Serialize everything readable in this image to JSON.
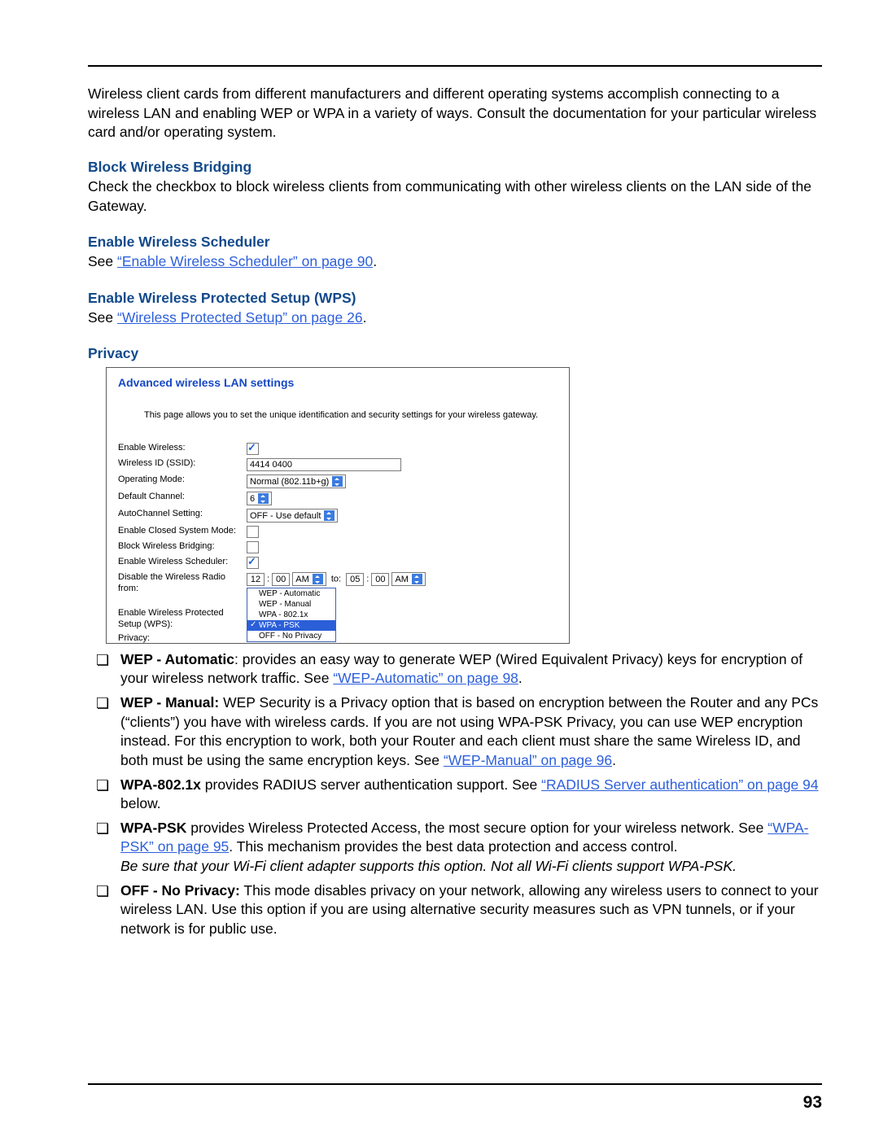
{
  "intro_text": "Wireless client cards from different manufacturers and different operating systems accomplish connecting to a wireless LAN and enabling WEP or WPA in a variety of ways. Consult the documentation for your particular wireless card and/or operating system.",
  "h1": {
    "title": "Block Wireless Bridging",
    "body": "Check the checkbox to block wireless clients from communicating with other wireless clients on the LAN side of the Gateway."
  },
  "h2": {
    "title": "Enable Wireless Scheduler",
    "see": "See ",
    "link": "“Enable Wireless Scheduler” on page 90",
    "after": "."
  },
  "h3": {
    "title": "Enable Wireless Protected Setup (WPS)",
    "see": "See ",
    "link": "“Wireless Protected Setup” on page 26",
    "after": "."
  },
  "h4": {
    "title": "Privacy"
  },
  "shot": {
    "title": "Advanced wireless LAN settings",
    "desc": "This page allows you to set the unique identification and security settings for your wireless gateway.",
    "rows": {
      "enable_wireless": "Enable Wireless:",
      "ssid_label": "Wireless ID (SSID):",
      "ssid_value": "4414 0400",
      "mode_label": "Operating Mode:",
      "mode_value": "Normal (802.11b+g)",
      "chan_label": "Default Channel:",
      "chan_value": "6",
      "auto_label": "AutoChannel Setting:",
      "auto_value": "OFF - Use default",
      "closed_label": "Enable Closed System Mode:",
      "block_label": "Block Wireless Bridging:",
      "sched_label": "Enable Wireless Scheduler:",
      "disable_label": "Disable the Wireless Radio from:",
      "disable_hh1": "12",
      "disable_mm1": "00",
      "disable_ap1": "AM",
      "to": "to:",
      "disable_hh2": "05",
      "disable_mm2": "00",
      "disable_ap2": "AM",
      "wps_label": "Enable Wireless Protected Setup (WPS):",
      "privacy_label": "Privacy:"
    },
    "privacy_opts": [
      "WEP - Automatic",
      "WEP - Manual",
      "WPA - 802.1x",
      "WPA - PSK",
      "OFF - No Privacy"
    ]
  },
  "list": {
    "wep_auto_b": "WEP - Automatic",
    "wep_auto_t1": ": provides an easy way to generate WEP (Wired Equivalent Privacy) keys for encryption of your wireless network traffic. See ",
    "wep_auto_link": "“WEP-Automatic” on page 98",
    "wep_auto_t2": ".",
    "wep_man_b": "WEP - Manual:",
    "wep_man_t1": " WEP Security is a Privacy option that is based on encryption between the Router and any PCs (“clients”) you have with wireless cards. If you are not using WPA-PSK Privacy, you can use WEP encryption instead. For this encryption to work, both your Router and each client must share the same Wireless ID, and both must be using the same encryption keys. See ",
    "wep_man_link": "“WEP-Manual” on page 96",
    "wep_man_t2": ".",
    "wpa_b": "WPA-802.1x",
    "wpa_t1": " provides RADIUS server authentication support. See ",
    "wpa_link": "“RADIUS Server authentication” on page 94",
    "wpa_t2": " below.",
    "psk_b": "WPA-PSK",
    "psk_t1": " provides Wireless Protected Access, the most secure option for your wireless network. See ",
    "psk_link": "“WPA-PSK” on page 95",
    "psk_t2": ". This mechanism provides the best data protection and access control.",
    "psk_it": "Be sure that your Wi-Fi client adapter supports this option. Not all Wi-Fi clients support WPA-PSK.",
    "off_b": "OFF - No Privacy:",
    "off_t": " This mode disables privacy on your network, allowing any wireless users to connect to your wireless LAN. Use this option if you are using alternative security measures such as VPN tunnels, or if your network is for public use."
  },
  "page_number": "93"
}
